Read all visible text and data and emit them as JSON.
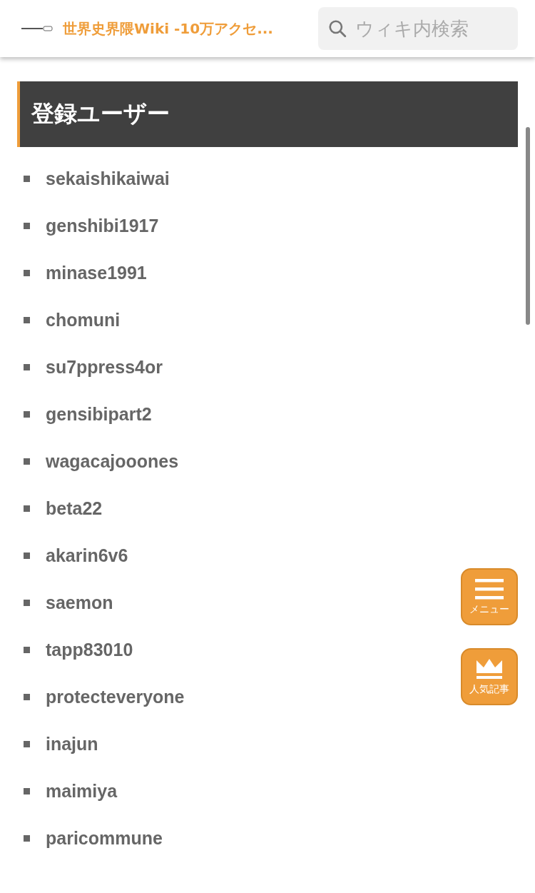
{
  "header": {
    "site_title": "世界史界隈Wiki -10万アクセ...",
    "search": {
      "placeholder": "ウィキ内検索"
    }
  },
  "section": {
    "title": "登録ユーザー"
  },
  "users": [
    "sekaishikaiwai",
    "genshibi1917",
    "minase1991",
    "chomuni",
    "su7ppress4or",
    "gensibipart2",
    "wagacajooones",
    "beta22",
    "akarin6v6",
    "saemon",
    "tapp83010",
    "protecteveryone",
    "inajun",
    "maimiya",
    "paricommune"
  ],
  "floating_buttons": [
    {
      "kind": "menu",
      "label": "メニュー"
    },
    {
      "kind": "ranking",
      "label": "人気記事"
    }
  ]
}
